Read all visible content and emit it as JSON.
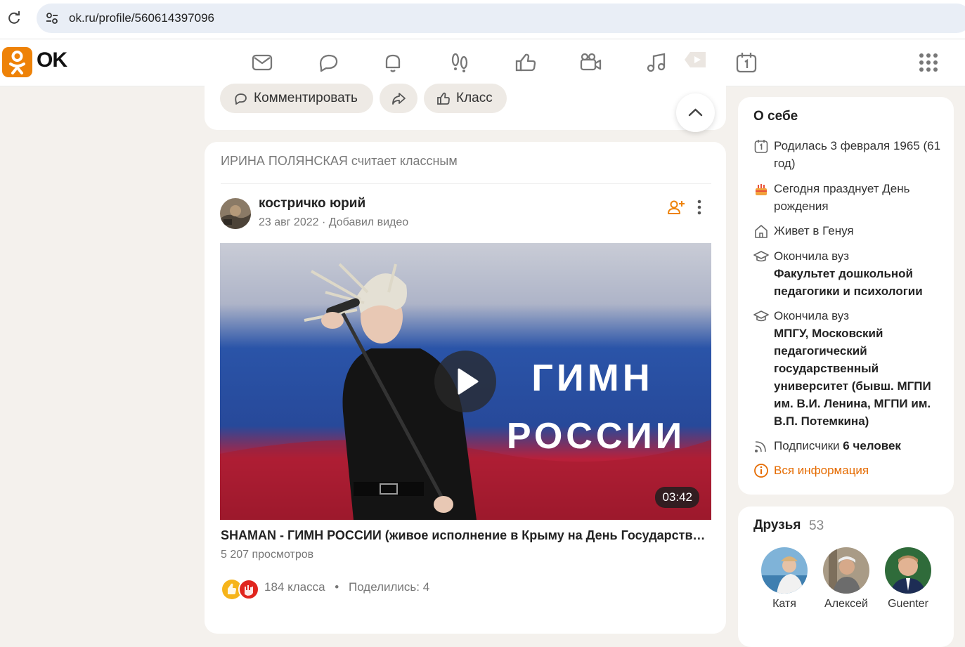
{
  "browser": {
    "url": "ok.ru/profile/560614397096"
  },
  "header": {
    "logo_text": "OK",
    "nav_icons": [
      "mail-icon",
      "discussions-icon",
      "notifications-icon",
      "guests-icon",
      "likes-icon",
      "video-icon",
      "music-icon",
      "play-icon",
      "calendar-icon",
      "apps-grid-icon"
    ]
  },
  "prev_post": {
    "comment_label": "Комментировать",
    "like_label": "Класс"
  },
  "post": {
    "liked_by": "ИРИНА ПОЛЯНСКАЯ считает классным",
    "author": "костричко юрий",
    "date": "23 авг 2022",
    "meta_sep": " · ",
    "action": "Добавил видео",
    "video": {
      "overlay_line1": "ГИМН",
      "overlay_line2": "РОССИИ",
      "duration": "03:42",
      "title": "SHAMAN - ГИМН РОССИИ (живое исполнение в Крыму на День Государственного флага РФ)",
      "views": "5 207 просмотров"
    },
    "likes": "184 класса",
    "bullet": "•",
    "shares": "Поделились: 4"
  },
  "about": {
    "title": "О себе",
    "born": "Родилась 3 февраля 1965 (61 год)",
    "birthday": "Сегодня празднует День рождения",
    "lives": "Живет в Генуя",
    "edu1_label": "Окончила вуз",
    "edu1_name": "Факультет дошкольной педагогики и психологии",
    "edu2_label": "Окончила вуз",
    "edu2_name": "МПГУ, Московский педагогический государственный университет (бывш. МГПИ им. В.И. Ленина, МГПИ им. В.П. Потемкина)",
    "subs_label": "Подписчики",
    "subs_count": "6 человек",
    "all_info": "Вся информация"
  },
  "friends": {
    "title": "Друзья",
    "count": "53",
    "list": [
      {
        "name": "Катя"
      },
      {
        "name": "Алексей"
      },
      {
        "name": "Guenter"
      }
    ]
  },
  "colors": {
    "brand": "#ee8208",
    "accent_text": "#e56b00",
    "background": "#f4f1ed"
  }
}
